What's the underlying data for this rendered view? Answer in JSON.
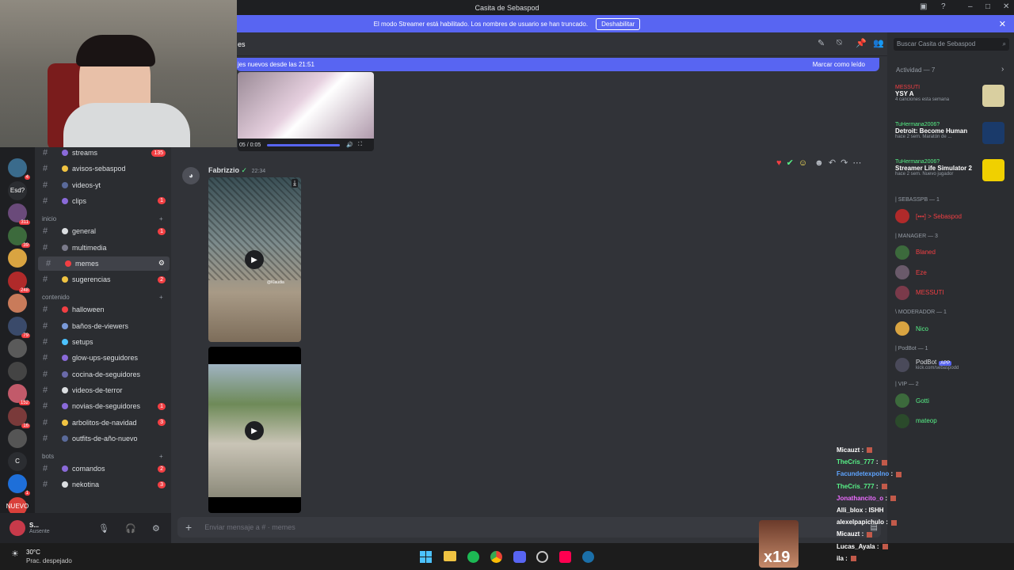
{
  "window": {
    "title": "Casita de Sebaspod"
  },
  "streamer_banner": {
    "text": "El modo Streamer está habilitado. Los nombres de usuario se han truncado.",
    "button": "Deshabilitar"
  },
  "servers": [
    {
      "badge": "4"
    },
    {
      "label": "Esd?"
    },
    {
      "badge": "311"
    },
    {
      "badge": "39"
    },
    {
      "badge": ""
    },
    {
      "badge": "248"
    },
    {
      "badge": ""
    },
    {
      "badge": "79"
    },
    {
      "badge": ""
    },
    {
      "badge": ""
    },
    {
      "badge": "152"
    },
    {
      "badge": "16"
    },
    {
      "badge": ""
    },
    {
      "label": "C"
    },
    {
      "badge": "1"
    },
    {
      "label": "NUEVO"
    }
  ],
  "channels": {
    "items": [
      {
        "name": "streams",
        "badge": "135"
      },
      {
        "name": "avisos-sebaspod",
        "badge": ""
      },
      {
        "name": "videos-yt",
        "badge": ""
      },
      {
        "name": "clips",
        "badge": "1"
      },
      {
        "category": "inicio"
      },
      {
        "name": "general",
        "badge": "1"
      },
      {
        "name": "multimedia",
        "badge": ""
      },
      {
        "name": "memes",
        "badge": "",
        "selected": true
      },
      {
        "name": "sugerencias",
        "badge": "2"
      },
      {
        "category": "contenido"
      },
      {
        "name": "halloween",
        "badge": ""
      },
      {
        "name": "baños-de-viewers",
        "badge": ""
      },
      {
        "name": "setups",
        "badge": ""
      },
      {
        "name": "glow-ups-seguidores",
        "badge": ""
      },
      {
        "name": "cocina-de-seguidores",
        "badge": ""
      },
      {
        "name": "videos-de-terror",
        "badge": ""
      },
      {
        "name": "novias-de-seguidores",
        "badge": "1"
      },
      {
        "name": "arbolitos-de-navidad",
        "badge": "3"
      },
      {
        "name": "outfits-de-año-nuevo",
        "badge": ""
      },
      {
        "category": "bots"
      },
      {
        "name": "comandos",
        "badge": "2"
      },
      {
        "name": "nekotina",
        "badge": "3"
      }
    ]
  },
  "user_panel": {
    "name": "S...",
    "status": "Ausente"
  },
  "chat": {
    "top_title": "es",
    "new_messages": "jes nuevos desde las 21:51",
    "mark_read": "Marcar como leído",
    "video_time": "05 / 0:05",
    "author": "Fabrizzio",
    "time": "22:34",
    "watermark": "@Klaudia",
    "input_placeholder": "Enviar mensaje a #  ·  memes"
  },
  "members": {
    "search_placeholder": "Buscar Casita de Sebaspod",
    "activity_header": "Actividad — 7",
    "activities": [
      {
        "user": "MESSUTI",
        "title": "YSY A",
        "sub": "4 canciones esta semana"
      },
      {
        "user": "TuHermana2006?",
        "title": "Detroit: Become Human",
        "sub": "hace 2 sem.  Maratón de ..."
      },
      {
        "user": "TuHermana2006?",
        "title": "Streamer Life Simulator 2",
        "sub": "hace 2 sem.  Nuevo jugador"
      }
    ],
    "sections": [
      {
        "label": "| SEBASSPB — 1",
        "members": [
          {
            "name": "[•••] > Sebaspod",
            "color": "#f23f43"
          }
        ]
      },
      {
        "label": "| MANAGER — 3",
        "members": [
          {
            "name": "Blaned",
            "color": "#f23f43"
          },
          {
            "name": "Eze",
            "color": "#f23f43"
          },
          {
            "name": "MESSUTI",
            "color": "#f23f43"
          }
        ]
      },
      {
        "label": "\\ MODERADOR — 1",
        "members": [
          {
            "name": "Nico",
            "color": "#57f287"
          }
        ]
      },
      {
        "label": "| PodBot — 1",
        "members": [
          {
            "name": "PodBot",
            "color": "#dbdee1",
            "tag": "APP",
            "sub": "kick.com/sebaspodd"
          }
        ]
      },
      {
        "label": "| VIP — 2",
        "members": [
          {
            "name": "Gotti",
            "color": "#57f287"
          },
          {
            "name": "mateop",
            "color": "#57f287"
          }
        ]
      }
    ]
  },
  "stream_chat": [
    {
      "user": "Micauzt",
      "color": "#ffffff",
      "msg": ""
    },
    {
      "user": "TheCris_777",
      "color": "#57f287",
      "msg": ""
    },
    {
      "user": "Facundetexpolno",
      "color": "#5ea4ff",
      "msg": ""
    },
    {
      "user": "TheCris_777",
      "color": "#57f287",
      "msg": ""
    },
    {
      "user": "Jonathancito_o",
      "color": "#eb6bff",
      "msg": ""
    },
    {
      "user": "Alli_blox",
      "color": "#ffffff",
      "msg": "ISHH"
    },
    {
      "user": "alexelpapichulo",
      "color": "#ffffff",
      "msg": ""
    },
    {
      "user": "Micauzt",
      "color": "#ffffff",
      "msg": ""
    },
    {
      "user": "Lucas_Ayala",
      "color": "#ffffff",
      "msg": ""
    },
    {
      "user": "ila",
      "color": "#ffffff",
      "msg": ""
    }
  ],
  "overlay_badge": "x19",
  "weather": {
    "temp": "30°C",
    "desc": "Prac. despejado"
  }
}
